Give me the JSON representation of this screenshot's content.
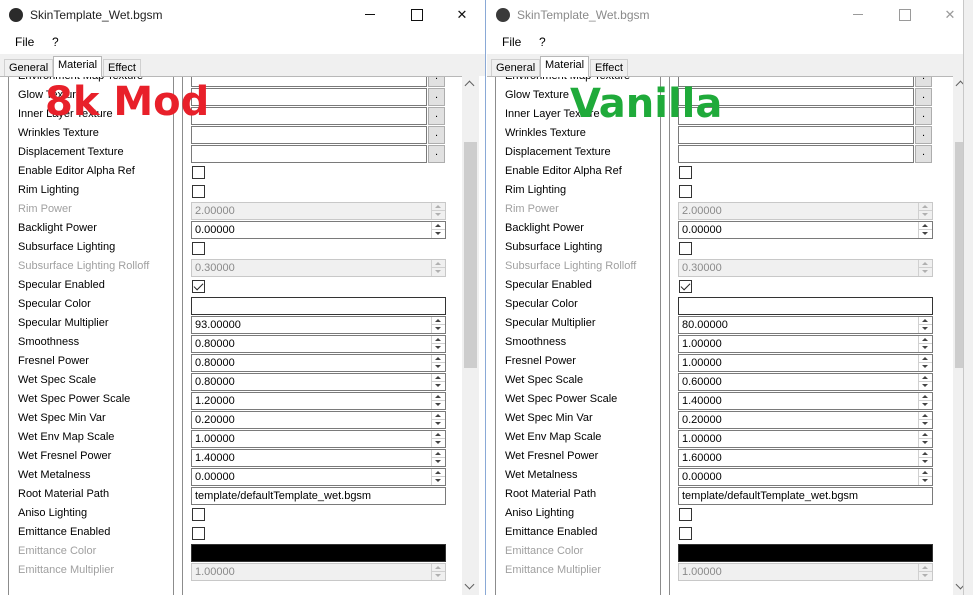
{
  "overlays": {
    "left": "8k Mod",
    "right": "Vanilla"
  },
  "windows": [
    {
      "id": "left",
      "title": "SkinTemplate_Wet.bgsm",
      "menu": [
        "File",
        "?"
      ],
      "tabs": [
        {
          "label": "General",
          "active": false
        },
        {
          "label": "Material",
          "active": true
        },
        {
          "label": "Effect",
          "active": false
        }
      ],
      "rows": [
        {
          "label": "Environment Map Texture",
          "type": "texture",
          "disabled": false
        },
        {
          "label": "Glow Texture",
          "type": "texture",
          "disabled": false
        },
        {
          "label": "Inner Layer Texture",
          "type": "texture",
          "disabled": false
        },
        {
          "label": "Wrinkles Texture",
          "type": "texture",
          "disabled": false
        },
        {
          "label": "Displacement Texture",
          "type": "texture",
          "disabled": false
        },
        {
          "label": "Enable Editor Alpha Ref",
          "type": "checkbox",
          "checked": false,
          "disabled": false
        },
        {
          "label": "Rim Lighting",
          "type": "checkbox",
          "checked": false,
          "disabled": false
        },
        {
          "label": "Rim Power",
          "type": "number",
          "value": "2.00000",
          "disabled": true
        },
        {
          "label": "Backlight Power",
          "type": "number",
          "value": "0.00000",
          "disabled": false
        },
        {
          "label": "Subsurface Lighting",
          "type": "checkbox",
          "checked": false,
          "disabled": false
        },
        {
          "label": "Subsurface Lighting Rolloff",
          "type": "number",
          "value": "0.30000",
          "disabled": true
        },
        {
          "label": "Specular Enabled",
          "type": "checkbox",
          "checked": true,
          "disabled": false
        },
        {
          "label": "Specular Color",
          "type": "color",
          "color": "#ffffff",
          "disabled": false
        },
        {
          "label": "Specular Multiplier",
          "type": "number",
          "value": "93.00000",
          "disabled": false
        },
        {
          "label": "Smoothness",
          "type": "number",
          "value": "0.80000",
          "disabled": false
        },
        {
          "label": "Fresnel Power",
          "type": "number",
          "value": "0.80000",
          "disabled": false
        },
        {
          "label": "Wet Spec Scale",
          "type": "number",
          "value": "0.80000",
          "disabled": false
        },
        {
          "label": "Wet Spec Power Scale",
          "type": "number",
          "value": "1.20000",
          "disabled": false
        },
        {
          "label": "Wet Spec Min Var",
          "type": "number",
          "value": "0.20000",
          "disabled": false
        },
        {
          "label": "Wet Env Map Scale",
          "type": "number",
          "value": "1.00000",
          "disabled": false
        },
        {
          "label": "Wet Fresnel Power",
          "type": "number",
          "value": "1.40000",
          "disabled": false
        },
        {
          "label": "Wet Metalness",
          "type": "number",
          "value": "0.00000",
          "disabled": false
        },
        {
          "label": "Root Material Path",
          "type": "text",
          "value": "template/defaultTemplate_wet.bgsm",
          "disabled": false
        },
        {
          "label": "Aniso Lighting",
          "type": "checkbox",
          "checked": false,
          "disabled": false
        },
        {
          "label": "Emittance Enabled",
          "type": "checkbox",
          "checked": false,
          "disabled": false
        },
        {
          "label": "Emittance Color",
          "type": "color",
          "color": "#000000",
          "disabled": true
        },
        {
          "label": "Emittance Multiplier",
          "type": "number",
          "value": "1.00000",
          "disabled": true
        }
      ]
    },
    {
      "id": "right",
      "title": "SkinTemplate_Wet.bgsm",
      "menu": [
        "File",
        "?"
      ],
      "tabs": [
        {
          "label": "General",
          "active": false
        },
        {
          "label": "Material",
          "active": true
        },
        {
          "label": "Effect",
          "active": false
        }
      ],
      "rows": [
        {
          "label": "Environment Map Texture",
          "type": "texture",
          "disabled": false
        },
        {
          "label": "Glow Texture",
          "type": "texture",
          "disabled": false
        },
        {
          "label": "Inner Layer Texture",
          "type": "texture",
          "disabled": false
        },
        {
          "label": "Wrinkles Texture",
          "type": "texture",
          "disabled": false
        },
        {
          "label": "Displacement Texture",
          "type": "texture",
          "disabled": false
        },
        {
          "label": "Enable Editor Alpha Ref",
          "type": "checkbox",
          "checked": false,
          "disabled": false
        },
        {
          "label": "Rim Lighting",
          "type": "checkbox",
          "checked": false,
          "disabled": false
        },
        {
          "label": "Rim Power",
          "type": "number",
          "value": "2.00000",
          "disabled": true
        },
        {
          "label": "Backlight Power",
          "type": "number",
          "value": "0.00000",
          "disabled": false
        },
        {
          "label": "Subsurface Lighting",
          "type": "checkbox",
          "checked": false,
          "disabled": false
        },
        {
          "label": "Subsurface Lighting Rolloff",
          "type": "number",
          "value": "0.30000",
          "disabled": true
        },
        {
          "label": "Specular Enabled",
          "type": "checkbox",
          "checked": true,
          "disabled": false
        },
        {
          "label": "Specular Color",
          "type": "color",
          "color": "#ffffff",
          "disabled": false
        },
        {
          "label": "Specular Multiplier",
          "type": "number",
          "value": "80.00000",
          "disabled": false
        },
        {
          "label": "Smoothness",
          "type": "number",
          "value": "1.00000",
          "disabled": false
        },
        {
          "label": "Fresnel Power",
          "type": "number",
          "value": "1.00000",
          "disabled": false
        },
        {
          "label": "Wet Spec Scale",
          "type": "number",
          "value": "0.60000",
          "disabled": false
        },
        {
          "label": "Wet Spec Power Scale",
          "type": "number",
          "value": "1.40000",
          "disabled": false
        },
        {
          "label": "Wet Spec Min Var",
          "type": "number",
          "value": "0.20000",
          "disabled": false
        },
        {
          "label": "Wet Env Map Scale",
          "type": "number",
          "value": "1.00000",
          "disabled": false
        },
        {
          "label": "Wet Fresnel Power",
          "type": "number",
          "value": "1.60000",
          "disabled": false
        },
        {
          "label": "Wet Metalness",
          "type": "number",
          "value": "0.00000",
          "disabled": false
        },
        {
          "label": "Root Material Path",
          "type": "text",
          "value": "template/defaultTemplate_wet.bgsm",
          "disabled": false
        },
        {
          "label": "Aniso Lighting",
          "type": "checkbox",
          "checked": false,
          "disabled": false
        },
        {
          "label": "Emittance Enabled",
          "type": "checkbox",
          "checked": false,
          "disabled": false
        },
        {
          "label": "Emittance Color",
          "type": "color",
          "color": "#000000",
          "disabled": true
        },
        {
          "label": "Emittance Multiplier",
          "type": "number",
          "value": "1.00000",
          "disabled": true
        }
      ]
    }
  ]
}
